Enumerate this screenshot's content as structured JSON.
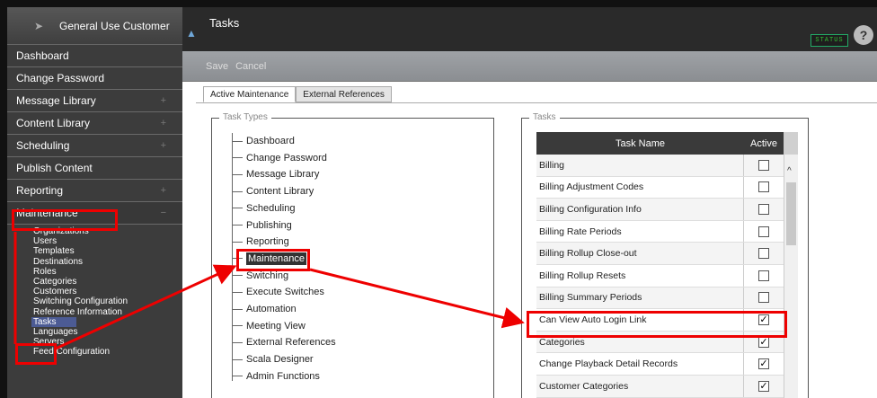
{
  "sidebar": {
    "brand": "General Use Customer",
    "items": [
      {
        "label": "Dashboard",
        "expandable": false
      },
      {
        "label": "Change Password",
        "expandable": false
      },
      {
        "label": "Message Library",
        "expandable": true
      },
      {
        "label": "Content Library",
        "expandable": true
      },
      {
        "label": "Scheduling",
        "expandable": true
      },
      {
        "label": "Publish Content",
        "expandable": false
      },
      {
        "label": "Reporting",
        "expandable": true
      },
      {
        "label": "Maintenance",
        "expandable": true
      }
    ],
    "maintenance_sub": [
      "Organizations",
      "Users",
      "Templates",
      "Destinations",
      "Roles",
      "Categories",
      "Customers",
      "Switching Configuration",
      "Reference Information",
      "Tasks",
      "Languages",
      "Servers",
      "Feed Configuration"
    ],
    "active_sub": "Tasks"
  },
  "header": {
    "title": "Tasks",
    "status_label": "STATUS",
    "help": "?"
  },
  "toolbar": {
    "save_label": "Save",
    "cancel_label": "Cancel"
  },
  "tabs": [
    {
      "label": "Active Maintenance",
      "active": true
    },
    {
      "label": "External References",
      "active": false
    }
  ],
  "task_types": {
    "legend": "Task Types",
    "items": [
      "Dashboard",
      "Change Password",
      "Message Library",
      "Content Library",
      "Scheduling",
      "Publishing",
      "Reporting",
      "Maintenance",
      "Switching",
      "Execute Switches",
      "Automation",
      "Meeting View",
      "External References",
      "Scala Designer",
      "Admin Functions"
    ],
    "selected": "Maintenance"
  },
  "tasks": {
    "legend": "Tasks",
    "col_name": "Task Name",
    "col_active": "Active",
    "rows": [
      {
        "name": "Billing",
        "active": false
      },
      {
        "name": "Billing Adjustment Codes",
        "active": false
      },
      {
        "name": "Billing Configuration Info",
        "active": false
      },
      {
        "name": "Billing Rate Periods",
        "active": false
      },
      {
        "name": "Billing Rollup Close-out",
        "active": false
      },
      {
        "name": "Billing Rollup Resets",
        "active": false
      },
      {
        "name": "Billing Summary Periods",
        "active": false
      },
      {
        "name": "Can View Auto Login Link",
        "active": true
      },
      {
        "name": "Categories",
        "active": true
      },
      {
        "name": "Change Playback Detail Records",
        "active": true
      },
      {
        "name": "Customer Categories",
        "active": true
      }
    ]
  },
  "colors": {
    "highlight": "#e00000",
    "sidebar_bg": "#3c3c3c",
    "selected_sub": "#4c5b94"
  }
}
